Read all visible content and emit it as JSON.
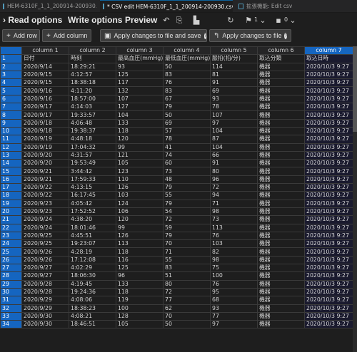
{
  "tabs": [
    {
      "label": "HEM-6310F_1_1_200914-200930.csv",
      "active": false
    },
    {
      "label": "* CSV edit HEM-6310F_1_1_200914-200930.csv",
      "active": true
    },
    {
      "label": "拡張機能: Edit csv",
      "active": false
    }
  ],
  "menu": {
    "read": "Read options",
    "write": "Write options",
    "preview": "Preview"
  },
  "toolbar": {
    "freeze_count": "1",
    "other_count": "0"
  },
  "buttons": {
    "add_row": "Add row",
    "add_column": "Add column",
    "apply_save": "Apply changes to file and save",
    "apply": "Apply changes to file"
  },
  "columns": [
    "column 1",
    "column 2",
    "column 3",
    "column 4",
    "column 5",
    "column 6",
    "column 7"
  ],
  "rows": [
    [
      "日付",
      "時刻",
      "最高血圧(mmHg)",
      "最低血圧(mmHg)",
      "脈拍(拍/分)",
      "取込分類",
      "取込日時"
    ],
    [
      "2020/9/14",
      "18:29:21",
      "93",
      "50",
      "114",
      "機器",
      "2020/10/3 9:27"
    ],
    [
      "2020/9/15",
      "4:12:57",
      "125",
      "83",
      "81",
      "機器",
      "2020/10/3 9:27"
    ],
    [
      "2020/9/15",
      "18:38:18",
      "117",
      "76",
      "91",
      "機器",
      "2020/10/3 9:27"
    ],
    [
      "2020/9/16",
      "4:11:20",
      "132",
      "83",
      "69",
      "機器",
      "2020/10/3 9:27"
    ],
    [
      "2020/9/16",
      "18:57:00",
      "107",
      "67",
      "93",
      "機器",
      "2020/10/3 9:27"
    ],
    [
      "2020/9/17",
      "4:14:03",
      "127",
      "79",
      "78",
      "機器",
      "2020/10/3 9:27"
    ],
    [
      "2020/9/17",
      "19:33:57",
      "104",
      "50",
      "107",
      "機器",
      "2020/10/3 9:27"
    ],
    [
      "2020/9/18",
      "4:06:48",
      "133",
      "69",
      "97",
      "機器",
      "2020/10/3 9:27"
    ],
    [
      "2020/9/18",
      "19:38:37",
      "118",
      "57",
      "104",
      "機器",
      "2020/10/3 9:27"
    ],
    [
      "2020/9/19",
      "4:48:18",
      "120",
      "78",
      "87",
      "機器",
      "2020/10/3 9:27"
    ],
    [
      "2020/9/19",
      "17:04:32",
      "99",
      "41",
      "104",
      "機器",
      "2020/10/3 9:27"
    ],
    [
      "2020/9/20",
      "4:31:57",
      "121",
      "74",
      "66",
      "機器",
      "2020/10/3 9:27"
    ],
    [
      "2020/9/20",
      "19:53:49",
      "105",
      "60",
      "91",
      "機器",
      "2020/10/3 9:27"
    ],
    [
      "2020/9/21",
      "3:44:42",
      "123",
      "73",
      "80",
      "機器",
      "2020/10/3 9:27"
    ],
    [
      "2020/9/21",
      "17:59:33",
      "110",
      "48",
      "96",
      "機器",
      "2020/10/3 9:27"
    ],
    [
      "2020/9/22",
      "4:13:15",
      "126",
      "79",
      "72",
      "機器",
      "2020/10/3 9:27"
    ],
    [
      "2020/9/22",
      "16:17:45",
      "103",
      "55",
      "94",
      "機器",
      "2020/10/3 9:27"
    ],
    [
      "2020/9/23",
      "4:05:42",
      "124",
      "79",
      "71",
      "機器",
      "2020/10/3 9:27"
    ],
    [
      "2020/9/23",
      "17:52:52",
      "106",
      "54",
      "98",
      "機器",
      "2020/10/3 9:27"
    ],
    [
      "2020/9/24",
      "4:38:20",
      "120",
      "72",
      "73",
      "機器",
      "2020/10/3 9:27"
    ],
    [
      "2020/9/24",
      "18:01:46",
      "99",
      "59",
      "113",
      "機器",
      "2020/10/3 9:27"
    ],
    [
      "2020/9/25",
      "4:45:51",
      "126",
      "79",
      "76",
      "機器",
      "2020/10/3 9:27"
    ],
    [
      "2020/9/25",
      "19:23:07",
      "113",
      "70",
      "103",
      "機器",
      "2020/10/3 9:27"
    ],
    [
      "2020/9/26",
      "4:28:19",
      "118",
      "71",
      "82",
      "機器",
      "2020/10/3 9:27"
    ],
    [
      "2020/9/26",
      "17:12:08",
      "116",
      "55",
      "98",
      "機器",
      "2020/10/3 9:27"
    ],
    [
      "2020/9/27",
      "4:02:29",
      "125",
      "83",
      "75",
      "機器",
      "2020/10/3 9:27"
    ],
    [
      "2020/9/27",
      "18:06:30",
      "96",
      "51",
      "100",
      "機器",
      "2020/10/3 9:27"
    ],
    [
      "2020/9/28",
      "4:19:45",
      "133",
      "80",
      "76",
      "機器",
      "2020/10/3 9:27"
    ],
    [
      "2020/9/28",
      "19:24:36",
      "118",
      "72",
      "95",
      "機器",
      "2020/10/3 9:27"
    ],
    [
      "2020/9/29",
      "4:08:06",
      "119",
      "77",
      "68",
      "機器",
      "2020/10/3 9:27"
    ],
    [
      "2020/9/29",
      "18:38:23",
      "100",
      "62",
      "93",
      "機器",
      "2020/10/3 9:27"
    ],
    [
      "2020/9/30",
      "4:08:21",
      "128",
      "70",
      "77",
      "機器",
      "2020/10/3 9:27"
    ],
    [
      "2020/9/30",
      "18:46:51",
      "105",
      "50",
      "97",
      "機器",
      "2020/10/3 9:27"
    ]
  ],
  "colors": {
    "accent": "#1565c0",
    "background": "#1e1e1e"
  }
}
